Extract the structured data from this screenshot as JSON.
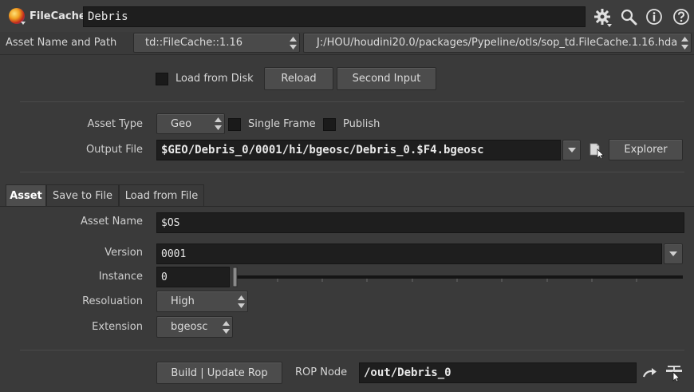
{
  "header": {
    "node_type": "FileCache",
    "node_name": "Debris"
  },
  "asset_row": {
    "label": "Asset Name and Path",
    "asset_definition": "td::FileCache::1.16",
    "asset_path": "J:/HOU/houdini20.0/packages/Pypeline/otls/sop_td.FileCache.1.16.hda"
  },
  "top_controls": {
    "load_from_disk_label": "Load from Disk",
    "load_from_disk_checked": false,
    "reload_label": "Reload",
    "second_input_label": "Second Input"
  },
  "asset_type": {
    "label": "Asset Type",
    "value": "Geo",
    "single_frame_label": "Single Frame",
    "single_frame_checked": false,
    "publish_label": "Publish",
    "publish_checked": false
  },
  "output_file": {
    "label": "Output File",
    "value": "$GEO/Debris_0/0001/hi/bgeosc/Debris_0.$F4.bgeosc",
    "explorer_label": "Explorer"
  },
  "tabs": [
    {
      "label": "Asset",
      "active": true
    },
    {
      "label": "Save to File",
      "active": false
    },
    {
      "label": "Load from File",
      "active": false
    }
  ],
  "asset_tab": {
    "asset_name_label": "Asset Name",
    "asset_name_value": "$OS",
    "version_label": "Version",
    "version_value": "0001",
    "instance_label": "Instance",
    "instance_value": "0",
    "resolution_label": "Resoluation",
    "resolution_value": "High",
    "extension_label": "Extension",
    "extension_value": "bgeosc"
  },
  "rop": {
    "build_label": "Build | Update Rop",
    "rop_node_label": "ROP Node",
    "rop_node_value": "/out/Debris_0"
  },
  "icons": [
    "node-color-icon",
    "gear-icon",
    "search-icon",
    "info-icon",
    "help-icon",
    "file-browse-icon",
    "jump-icon",
    "pin-icon"
  ]
}
